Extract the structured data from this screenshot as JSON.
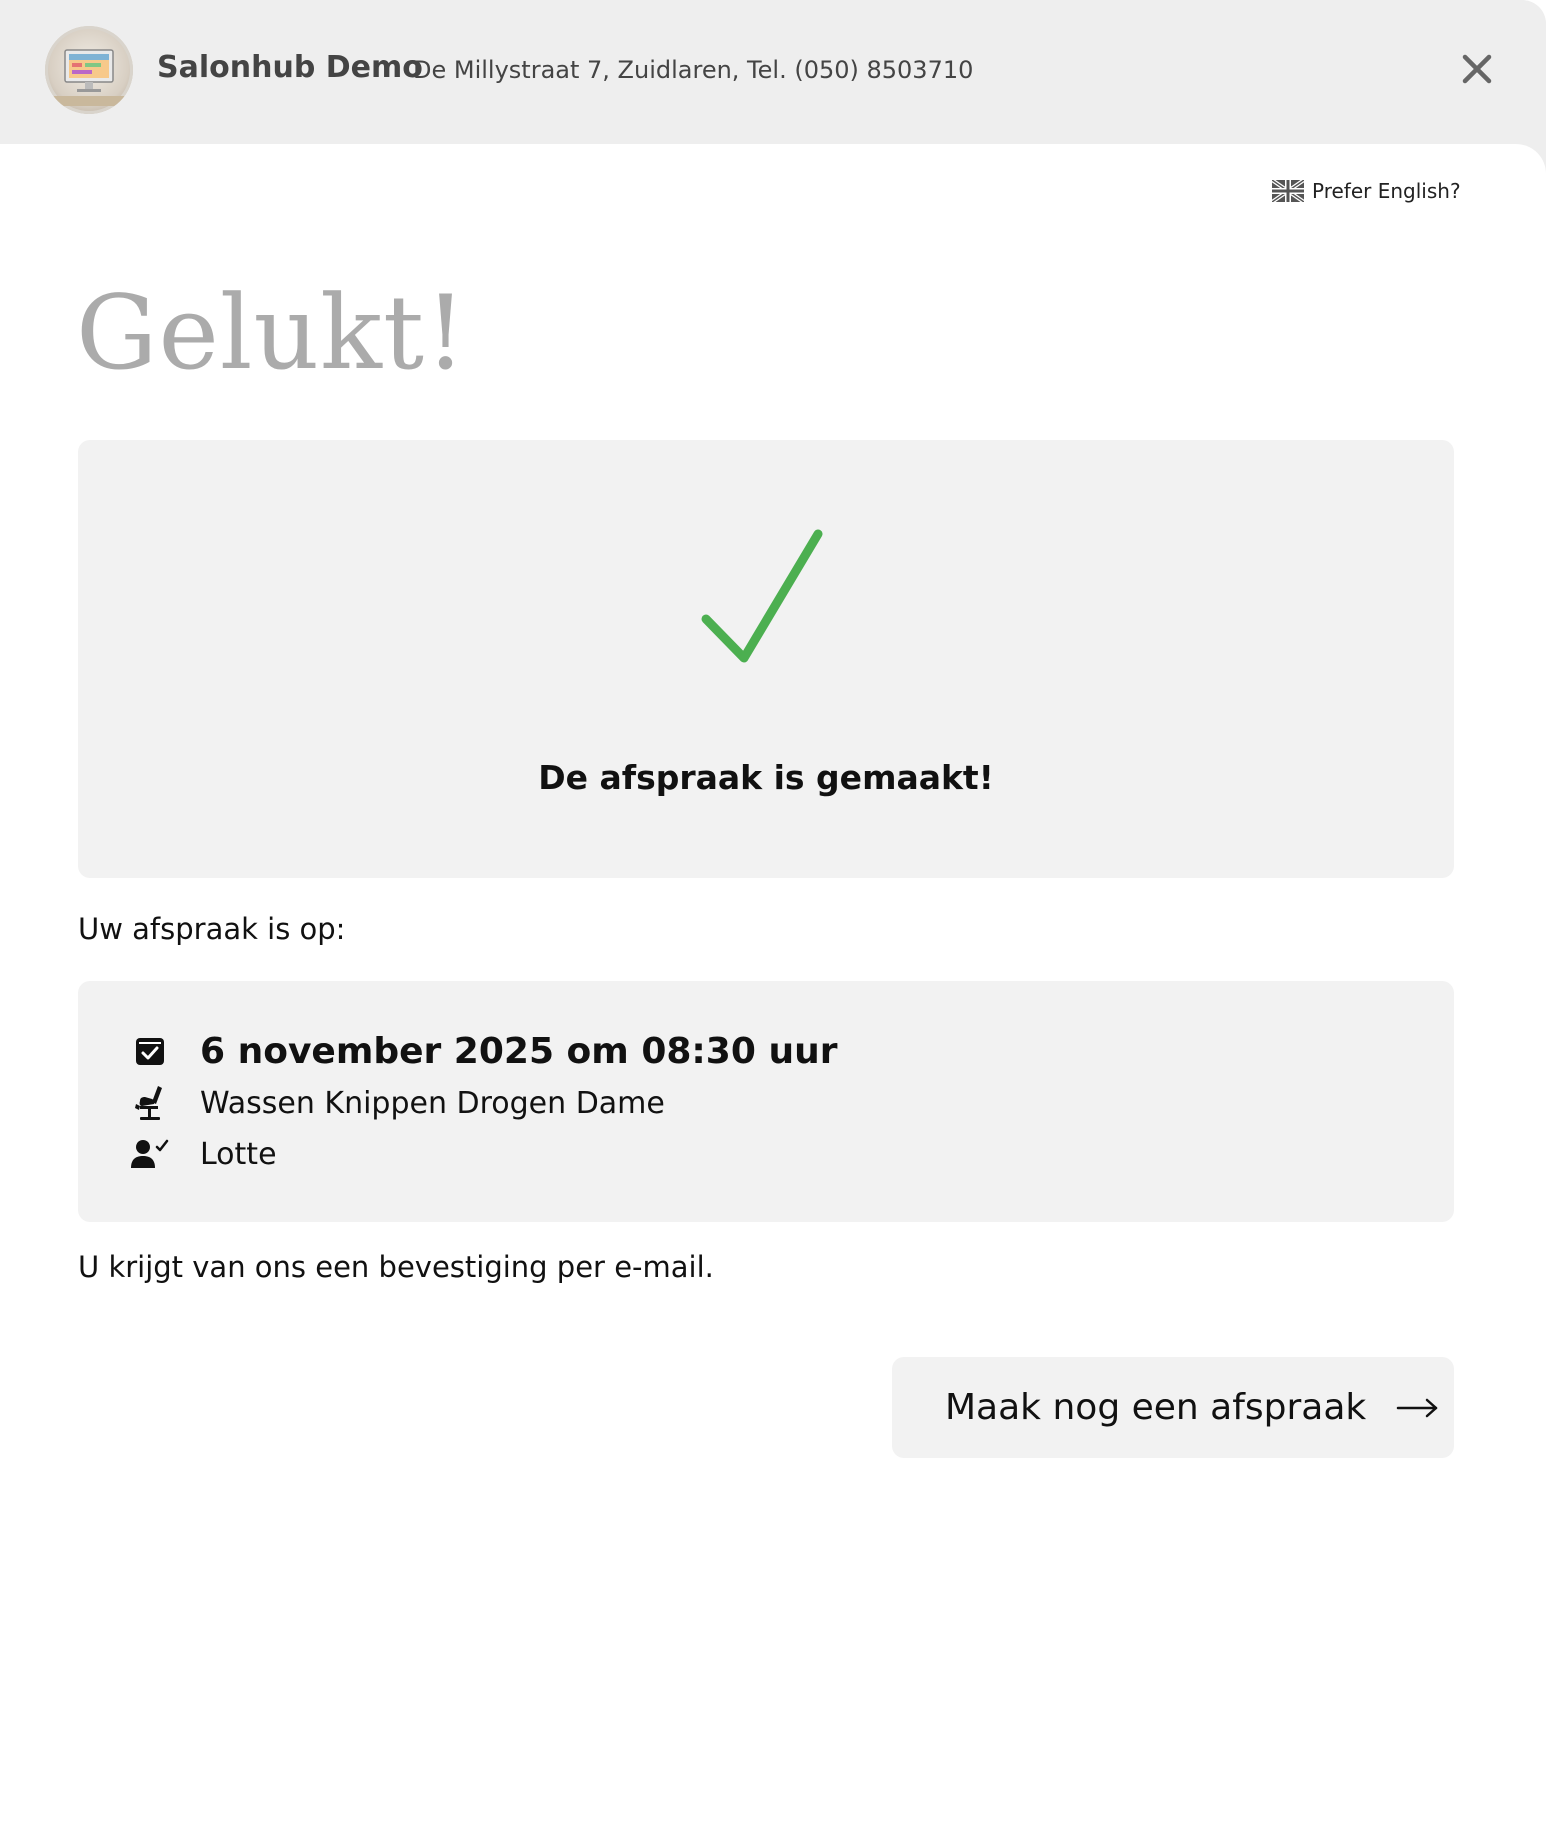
{
  "header": {
    "salon_name": "Salonhub Demo",
    "address": "De Millystraat 7, Zuidlaren, Tel. (050) 8503710",
    "close_icon": "close-icon"
  },
  "language": {
    "label": "Prefer English?",
    "flag_icon": "uk-flag-icon"
  },
  "page": {
    "headline": "Gelukt!"
  },
  "success": {
    "message": "De afspraak is gemaakt!",
    "icon": "checkmark-icon",
    "icon_color": "#4caf50"
  },
  "appointment": {
    "intro": "Uw afspraak is op:",
    "datetime": "6 november 2025 om 08:30 uur",
    "service": "Wassen Knippen Drogen Dame",
    "staff": "Lotte",
    "icons": {
      "date": "calendar-check-icon",
      "service": "salon-chair-icon",
      "staff": "user-check-icon"
    }
  },
  "confirmation": {
    "text": "U krijgt van ons een bevestiging per e-mail."
  },
  "actions": {
    "book_again_label": "Maak nog een afspraak",
    "book_again_icon": "arrow-right-icon"
  },
  "colors": {
    "header_bg": "#eeeeee",
    "panel_bg": "#f2f2f2",
    "headline": "#ababab",
    "accent_green": "#4caf50"
  }
}
